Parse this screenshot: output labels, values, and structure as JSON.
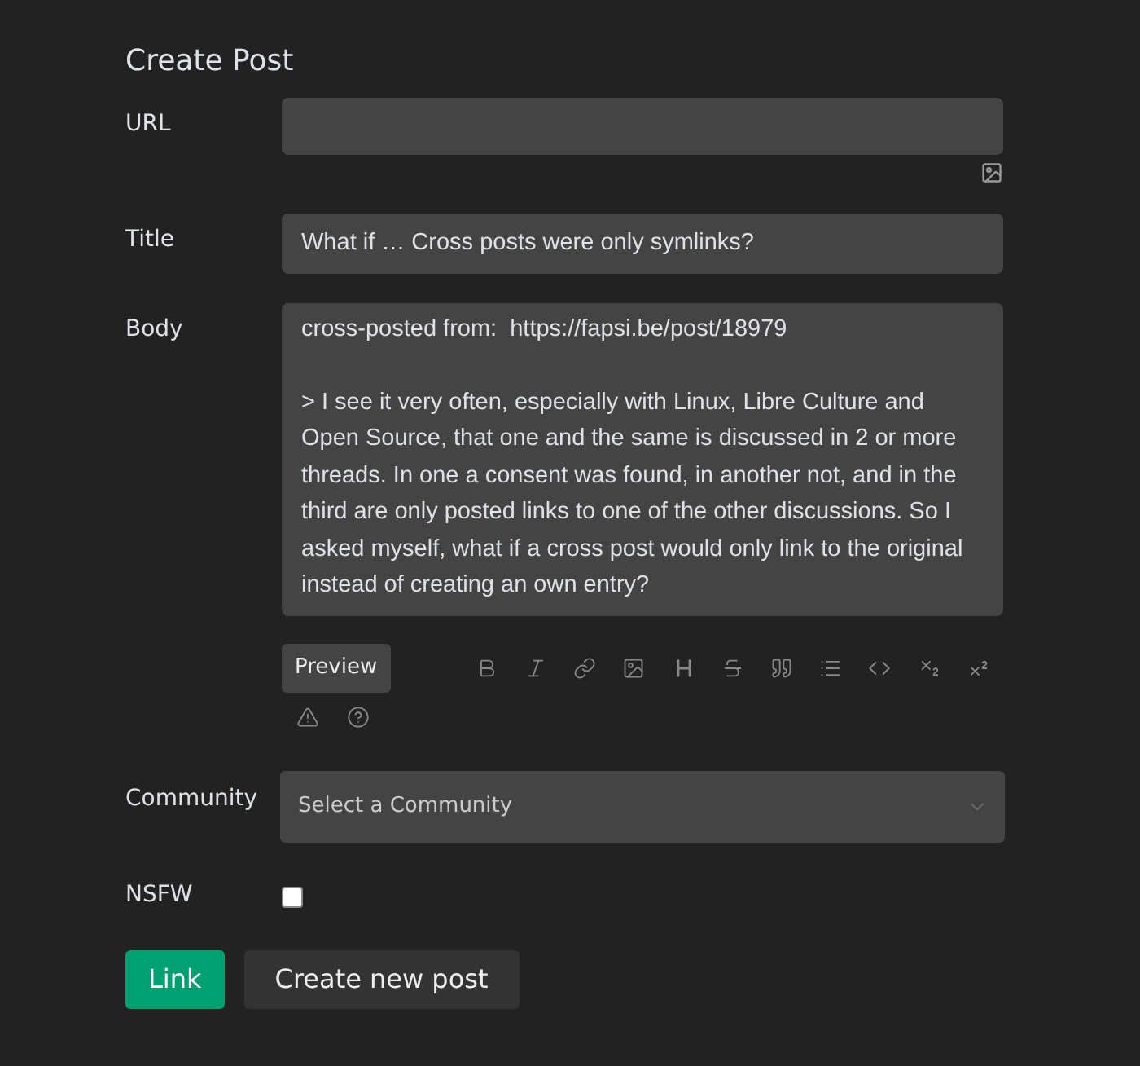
{
  "heading": "Create Post",
  "url": {
    "label": "URL"
  },
  "title": {
    "label": "Title",
    "value": "What if … Cross posts were only symlinks?"
  },
  "body": {
    "label": "Body",
    "value": "cross-posted from:  https://fapsi.be/post/18979\n\n> I see it very often, especially with Linux, Libre Culture and Open Source, that one and the same is discussed in 2 or more threads. In one a consent was found, in another not, and in the third are only posted links to one of the other discussions. So I asked myself, what if a cross post would only link to the original instead of creating an own entry?"
  },
  "preview_button": "Preview",
  "toolbar": [
    {
      "kind": "bold"
    },
    {
      "kind": "italic"
    },
    {
      "kind": "link"
    },
    {
      "kind": "image"
    },
    {
      "kind": "heading"
    },
    {
      "kind": "strike"
    },
    {
      "kind": "quote"
    },
    {
      "kind": "list"
    },
    {
      "kind": "code"
    },
    {
      "kind": "subscript"
    },
    {
      "kind": "superscript"
    }
  ],
  "toolbar_extra": [
    {
      "kind": "warning"
    },
    {
      "kind": "help"
    }
  ],
  "community": {
    "label": "Community",
    "placeholder": "Select a Community"
  },
  "nsfw": {
    "label": "NSFW",
    "checked": false
  },
  "buttons": [
    {
      "label": "Link",
      "kind": "primary"
    },
    {
      "label": "Create new post",
      "kind": "secondary"
    }
  ]
}
